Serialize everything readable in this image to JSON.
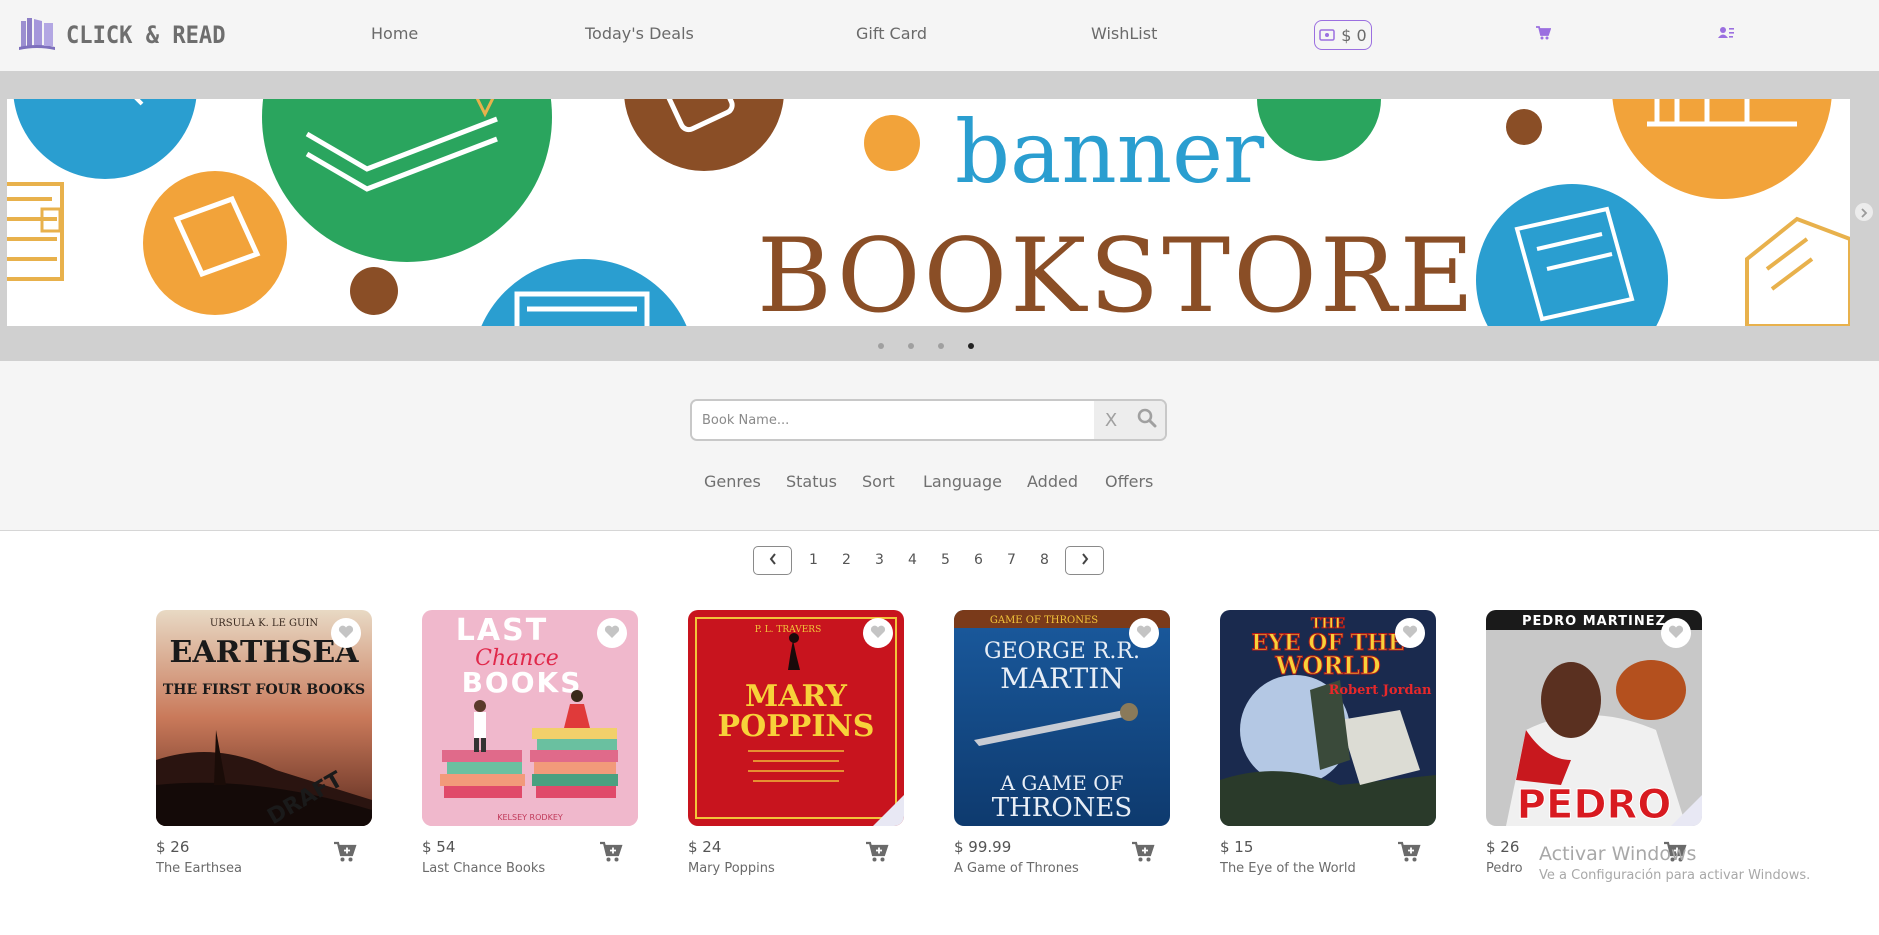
{
  "brand": {
    "name": "CLICK & READ",
    "logo_icon": "book-logo-icon"
  },
  "nav": {
    "links": [
      "Home",
      "Today's Deals",
      "Gift Card",
      "WishList"
    ],
    "wallet_amount": "$ 0",
    "cart_icon": "cart-icon",
    "account_icon": "user-list-icon"
  },
  "carousel": {
    "banner_word": "banner",
    "banner_title": "BOOKSTORE",
    "slide_count": 4,
    "active_slide": 4
  },
  "search": {
    "placeholder": "Book Name...",
    "clear_label": "X"
  },
  "filters": [
    "Genres",
    "Status",
    "Sort",
    "Language",
    "Added",
    "Offers"
  ],
  "pagination": {
    "pages": [
      "1",
      "2",
      "3",
      "4",
      "5",
      "6",
      "7",
      "8"
    ]
  },
  "books": [
    {
      "price": "$ 26",
      "title": "The Earthsea",
      "cover_author": "URSULA K. LE GUIN",
      "cover_title": "EARTHSEA",
      "cover_sub": "THE FIRST FOUR BOOKS",
      "cover_stamp": "DRAFT"
    },
    {
      "price": "$ 54",
      "title": "Last Chance Books",
      "cover_title": "LAST",
      "cover_title2": "Chance",
      "cover_title3": "BOOKS",
      "cover_author": "KELSEY RODKEY"
    },
    {
      "price": "$ 24",
      "title": "Mary Poppins",
      "cover_author": "P. L. TRAVERS",
      "cover_title": "MARY",
      "cover_title2": "POPPINS"
    },
    {
      "price": "$ 99.99",
      "title": "A Game of Thrones",
      "cover_series": "GAME OF THRONES",
      "cover_author": "GEORGE R.R.",
      "cover_author2": "MARTIN",
      "cover_title": "A GAME OF",
      "cover_title2": "THRONES"
    },
    {
      "price": "$ 15",
      "title": "The Eye of the World",
      "cover_title": "THE",
      "cover_title2": "EYE OF THE",
      "cover_title3": "WORLD",
      "cover_author": "Robert Jordan"
    },
    {
      "price": "$ 26",
      "title": "Pedro",
      "cover_author": "PEDRO MARTINEZ",
      "cover_title": "PEDRO"
    }
  ],
  "watermark": {
    "line1": "Activar Windows",
    "line2": "Ve a Configuración para activar Windows."
  },
  "colors": {
    "accent": "#9b6fe0",
    "background": "#f5f5f5",
    "carousel_bg": "#d0d0d0"
  }
}
